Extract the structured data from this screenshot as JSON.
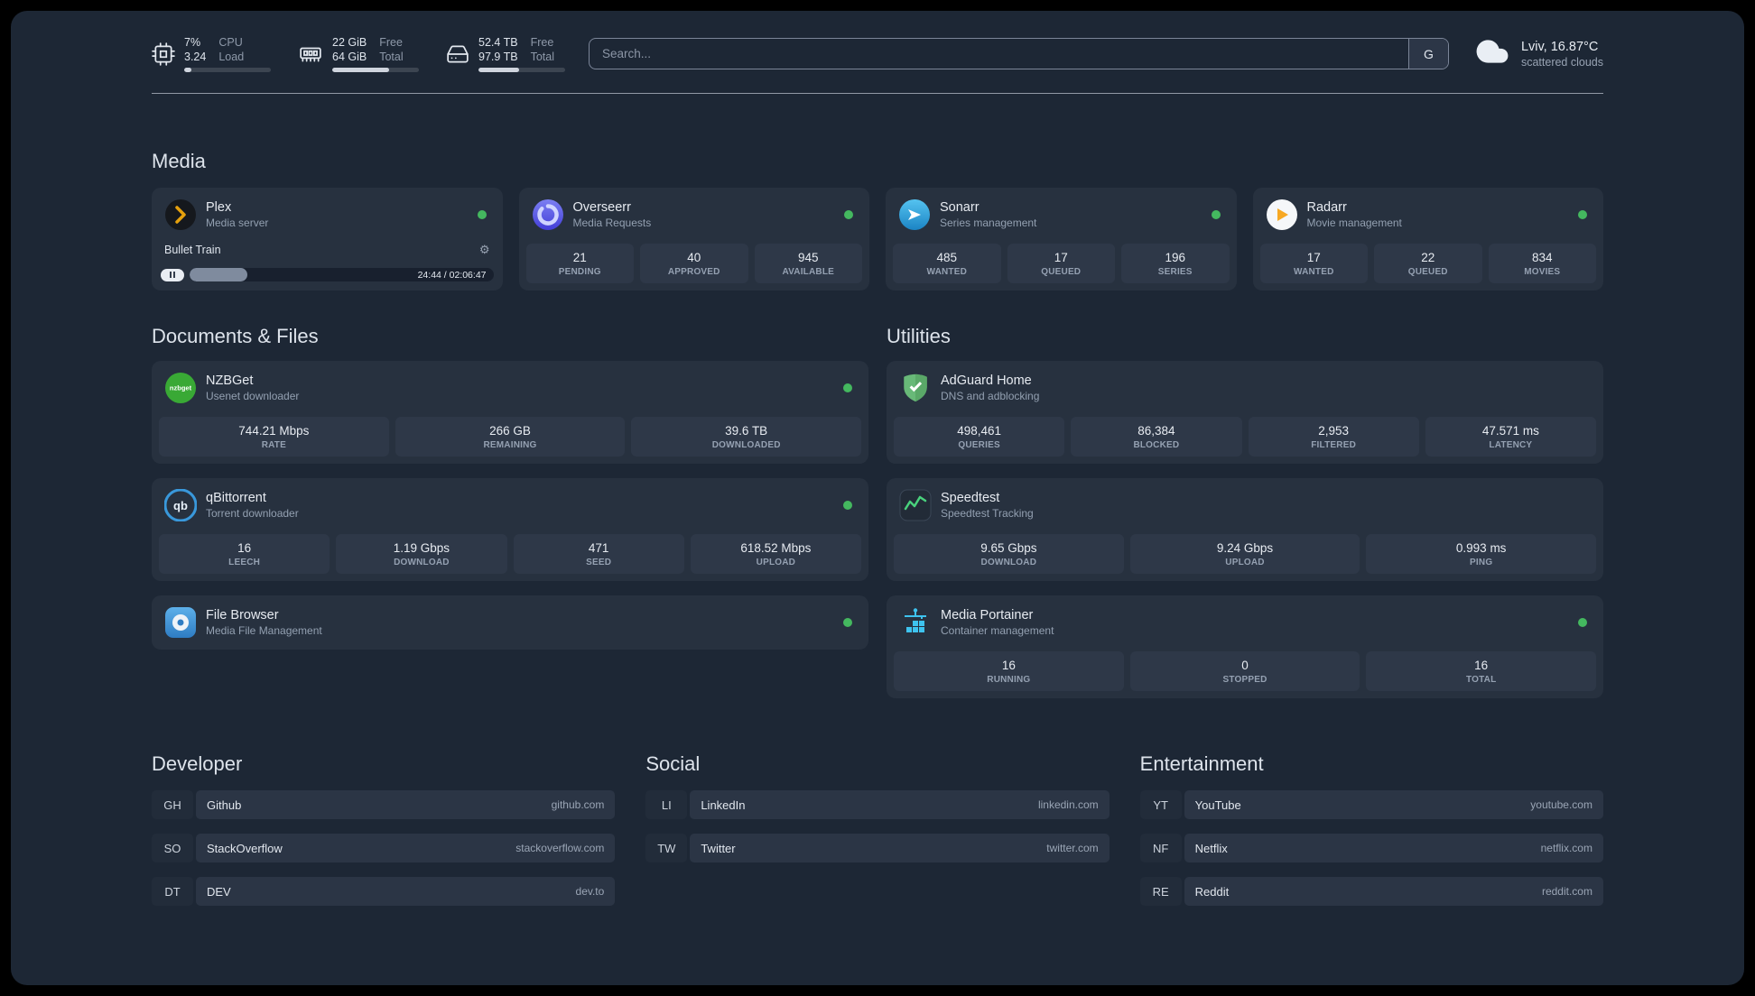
{
  "colors": {
    "status_online": "#44b85f",
    "plex_amber": "#e5a00d",
    "sonarr_blue": "#35a9e0",
    "radarr_gold": "#f7a823",
    "overseerr_purple": "#4f46e5",
    "nzbget_green": "#39a935",
    "qbittorrent_blue": "#3998db",
    "adguard_green": "#68b978",
    "speedtest_green": "#49d17c",
    "portainer_blue": "#3ec3ef"
  },
  "icons": {
    "gear": "⚙"
  },
  "header": {
    "cpu": {
      "value_top": "7%",
      "value_bottom": "3.24",
      "label_top": "CPU",
      "label_bottom": "Load",
      "bar_percent": 8
    },
    "memory": {
      "value_top": "22 GiB",
      "value_bottom": "64 GiB",
      "label_top": "Free",
      "label_bottom": "Total",
      "bar_percent": 66
    },
    "disk": {
      "value_top": "52.4 TB",
      "value_bottom": "97.9 TB",
      "label_top": "Free",
      "label_bottom": "Total",
      "bar_percent": 47
    },
    "search": {
      "placeholder": "Search...",
      "provider": "G"
    },
    "weather": {
      "location": "Lviv, 16.87°C",
      "condition": "scattered clouds"
    }
  },
  "sections": {
    "media": {
      "title": "Media",
      "plex": {
        "name": "Plex",
        "subtitle": "Media server",
        "now_playing": "Bullet Train",
        "elapsed": "24:44 / 02:06:47",
        "progress_percent": 19
      },
      "overseerr": {
        "name": "Overseerr",
        "subtitle": "Media Requests",
        "stats": [
          {
            "value": "21",
            "label": "PENDING"
          },
          {
            "value": "40",
            "label": "APPROVED"
          },
          {
            "value": "945",
            "label": "AVAILABLE"
          }
        ]
      },
      "sonarr": {
        "name": "Sonarr",
        "subtitle": "Series management",
        "stats": [
          {
            "value": "485",
            "label": "WANTED"
          },
          {
            "value": "17",
            "label": "QUEUED"
          },
          {
            "value": "196",
            "label": "SERIES"
          }
        ]
      },
      "radarr": {
        "name": "Radarr",
        "subtitle": "Movie management",
        "stats": [
          {
            "value": "17",
            "label": "WANTED"
          },
          {
            "value": "22",
            "label": "QUEUED"
          },
          {
            "value": "834",
            "label": "MOVIES"
          }
        ]
      }
    },
    "documents": {
      "title": "Documents & Files",
      "nzbget": {
        "name": "NZBGet",
        "subtitle": "Usenet downloader",
        "stats": [
          {
            "value": "744.21 Mbps",
            "label": "RATE"
          },
          {
            "value": "266 GB",
            "label": "REMAINING"
          },
          {
            "value": "39.6 TB",
            "label": "DOWNLOADED"
          }
        ]
      },
      "qbittorrent": {
        "name": "qBittorrent",
        "subtitle": "Torrent downloader",
        "stats": [
          {
            "value": "16",
            "label": "LEECH"
          },
          {
            "value": "1.19 Gbps",
            "label": "DOWNLOAD"
          },
          {
            "value": "471",
            "label": "SEED"
          },
          {
            "value": "618.52 Mbps",
            "label": "UPLOAD"
          }
        ]
      },
      "filebrowser": {
        "name": "File Browser",
        "subtitle": "Media File Management"
      }
    },
    "utilities": {
      "title": "Utilities",
      "adguard": {
        "name": "AdGuard Home",
        "subtitle": "DNS and adblocking",
        "stats": [
          {
            "value": "498,461",
            "label": "QUERIES"
          },
          {
            "value": "86,384",
            "label": "BLOCKED"
          },
          {
            "value": "2,953",
            "label": "FILTERED"
          },
          {
            "value": "47.571 ms",
            "label": "LATENCY"
          }
        ]
      },
      "speedtest": {
        "name": "Speedtest",
        "subtitle": "Speedtest Tracking",
        "stats": [
          {
            "value": "9.65 Gbps",
            "label": "DOWNLOAD"
          },
          {
            "value": "9.24 Gbps",
            "label": "UPLOAD"
          },
          {
            "value": "0.993 ms",
            "label": "PING"
          }
        ]
      },
      "portainer": {
        "name": "Media Portainer",
        "subtitle": "Container management",
        "stats": [
          {
            "value": "16",
            "label": "RUNNING"
          },
          {
            "value": "0",
            "label": "STOPPED"
          },
          {
            "value": "16",
            "label": "TOTAL"
          }
        ]
      }
    },
    "bookmarks": {
      "developer": {
        "title": "Developer",
        "items": [
          {
            "abbr": "GH",
            "name": "Github",
            "domain": "github.com"
          },
          {
            "abbr": "SO",
            "name": "StackOverflow",
            "domain": "stackoverflow.com"
          },
          {
            "abbr": "DT",
            "name": "DEV",
            "domain": "dev.to"
          }
        ]
      },
      "social": {
        "title": "Social",
        "items": [
          {
            "abbr": "LI",
            "name": "LinkedIn",
            "domain": "linkedin.com"
          },
          {
            "abbr": "TW",
            "name": "Twitter",
            "domain": "twitter.com"
          }
        ]
      },
      "entertainment": {
        "title": "Entertainment",
        "items": [
          {
            "abbr": "YT",
            "name": "YouTube",
            "domain": "youtube.com"
          },
          {
            "abbr": "NF",
            "name": "Netflix",
            "domain": "netflix.com"
          },
          {
            "abbr": "RE",
            "name": "Reddit",
            "domain": "reddit.com"
          }
        ]
      }
    }
  }
}
